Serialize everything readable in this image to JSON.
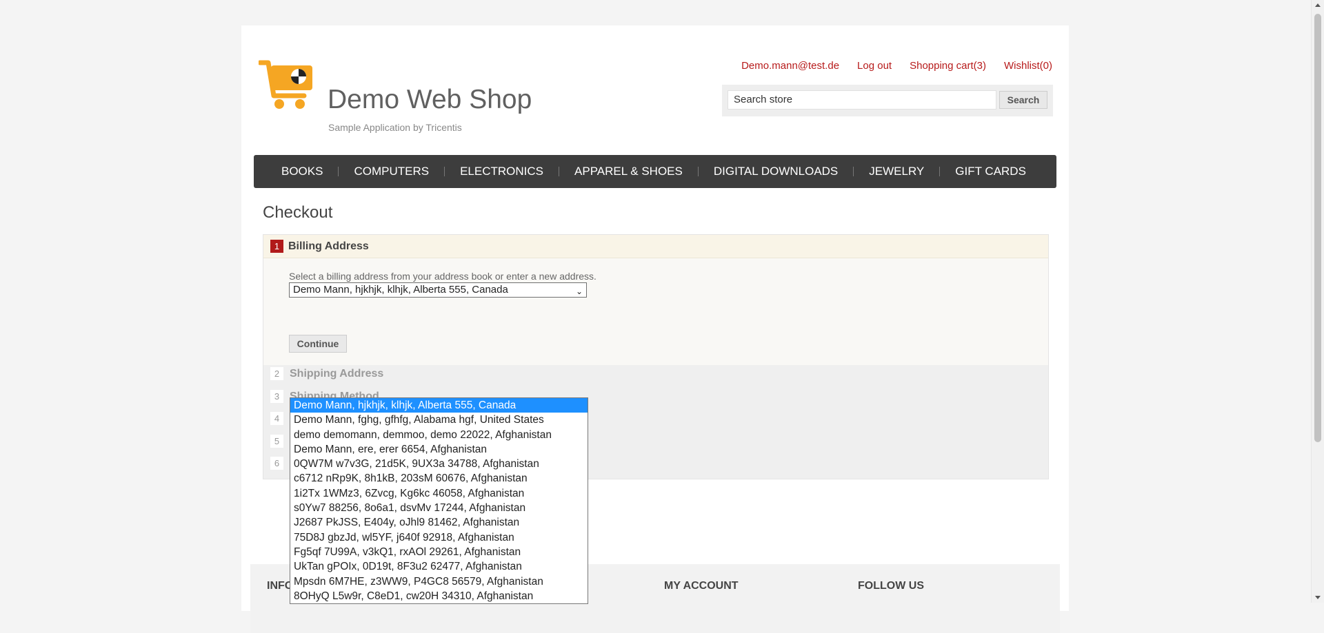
{
  "header": {
    "logo_title": "Demo Web Shop",
    "logo_subtitle": "Sample Application by Tricentis",
    "links": [
      "Demo.mann@test.de",
      "Log out",
      "Shopping cart(3)",
      "Wishlist(0)"
    ],
    "search_value": "Search store",
    "search_button": "Search"
  },
  "nav": [
    "BOOKS",
    "COMPUTERS",
    "ELECTRONICS",
    "APPAREL & SHOES",
    "DIGITAL DOWNLOADS",
    "JEWELRY",
    "GIFT CARDS"
  ],
  "checkout": {
    "title": "Checkout",
    "active_step": {
      "number": "1",
      "title": "Billing Address",
      "hint": "Select a billing address from your address book or enter a new address.",
      "selected_address": "Demo Mann, hjkhjk, klhjk, Alberta 555, Canada",
      "continue_label": "Continue"
    },
    "steps": [
      {
        "number": "2",
        "title": "Shipping Address"
      },
      {
        "number": "3",
        "title": "Shipping Method"
      },
      {
        "number": "4",
        "title": ""
      },
      {
        "number": "5",
        "title": ""
      },
      {
        "number": "6",
        "title": ""
      }
    ]
  },
  "address_options": [
    "Demo Mann, hjkhjk, klhjk, Alberta 555, Canada",
    "Demo Mann, fghg, gfhfg, Alabama hgf, United States",
    "demo demomann, demmoo, demo 22022, Afghanistan",
    "Demo Mann, ere, erer 6654, Afghanistan",
    "0QW7M w7v3G, 21d5K, 9UX3a 34788, Afghanistan",
    "c6712 nRp9K, 8h1kB, 203sM 60676, Afghanistan",
    "1i2Tx 1WMz3, 6Zvcg, Kg6kc 46058, Afghanistan",
    "s0Yw7 88256, 8o6a1, dsvMv 17244, Afghanistan",
    "J2687 PkJSS, E404y, oJhl9 81462, Afghanistan",
    "75D8J gbzJd, wl5YF, j640f 92918, Afghanistan",
    "Fg5qf 7U99A, v3kQ1, rxAOl 29261, Afghanistan",
    "UkTan gPOIx, 0D19t, 8F3u2 62477, Afghanistan",
    "Mpsdn 6M7HE, z3WW9, P4GC8 56579, Afghanistan",
    "8OHyQ L5w9r, C8eD1, cw20H 34310, Afghanistan"
  ],
  "footer": {
    "col1": "INFO",
    "col3": "MY ACCOUNT",
    "col4": "FOLLOW US"
  },
  "colors": {
    "accent_red": "#b71a1a",
    "nav_bg": "#3d3d3d",
    "selected_option": "#1e90ff",
    "logo_orange": "#f5a623"
  }
}
